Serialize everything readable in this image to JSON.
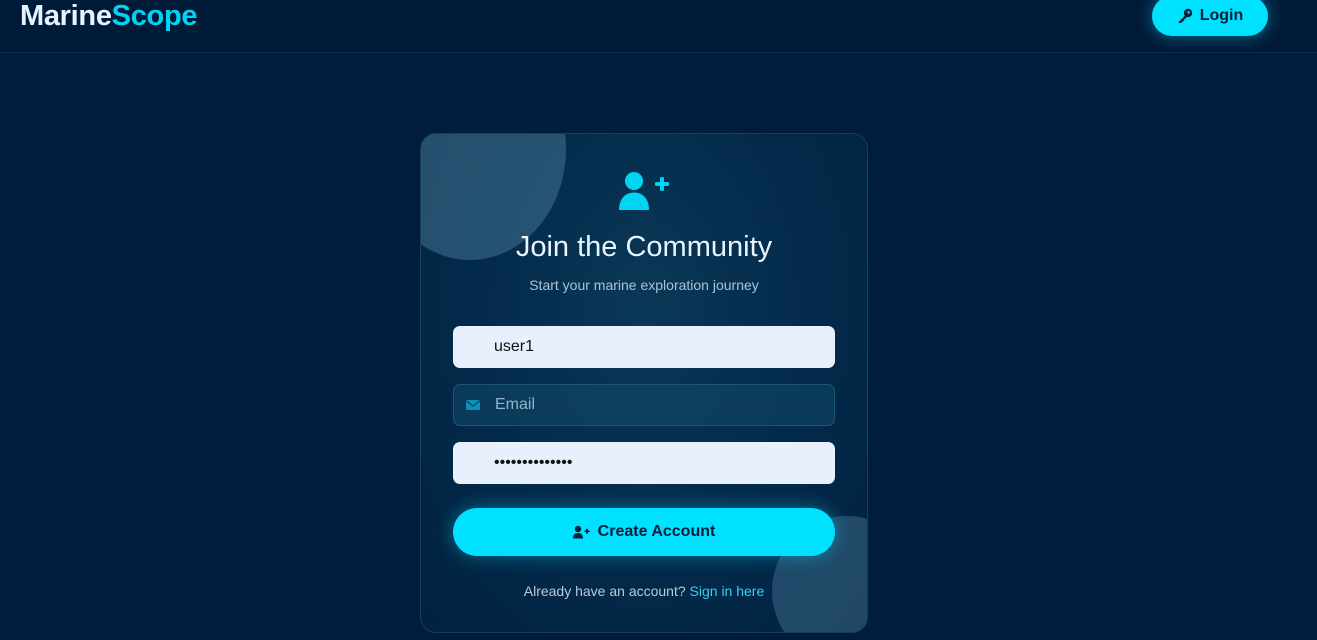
{
  "header": {
    "brand_part1": "Marine",
    "brand_part2": "Scope",
    "login_label": "Login",
    "login_icon": "key-icon"
  },
  "card": {
    "icon": "user-plus-icon",
    "title": "Join the Community",
    "subtitle": "Start your marine exploration journey",
    "fields": {
      "username": {
        "value": "user1",
        "placeholder": ""
      },
      "email": {
        "value": "",
        "placeholder": "Email",
        "icon": "envelope-icon"
      },
      "password": {
        "value": "••••••••••••••",
        "placeholder": ""
      }
    },
    "create_button": {
      "label": "Create Account",
      "icon": "user-plus-icon"
    },
    "signin_prompt": "Already have an account?",
    "signin_link": "Sign in here"
  },
  "colors": {
    "background": "#001d3d",
    "accent": "#00e1ff",
    "link": "#2fd4f7"
  }
}
